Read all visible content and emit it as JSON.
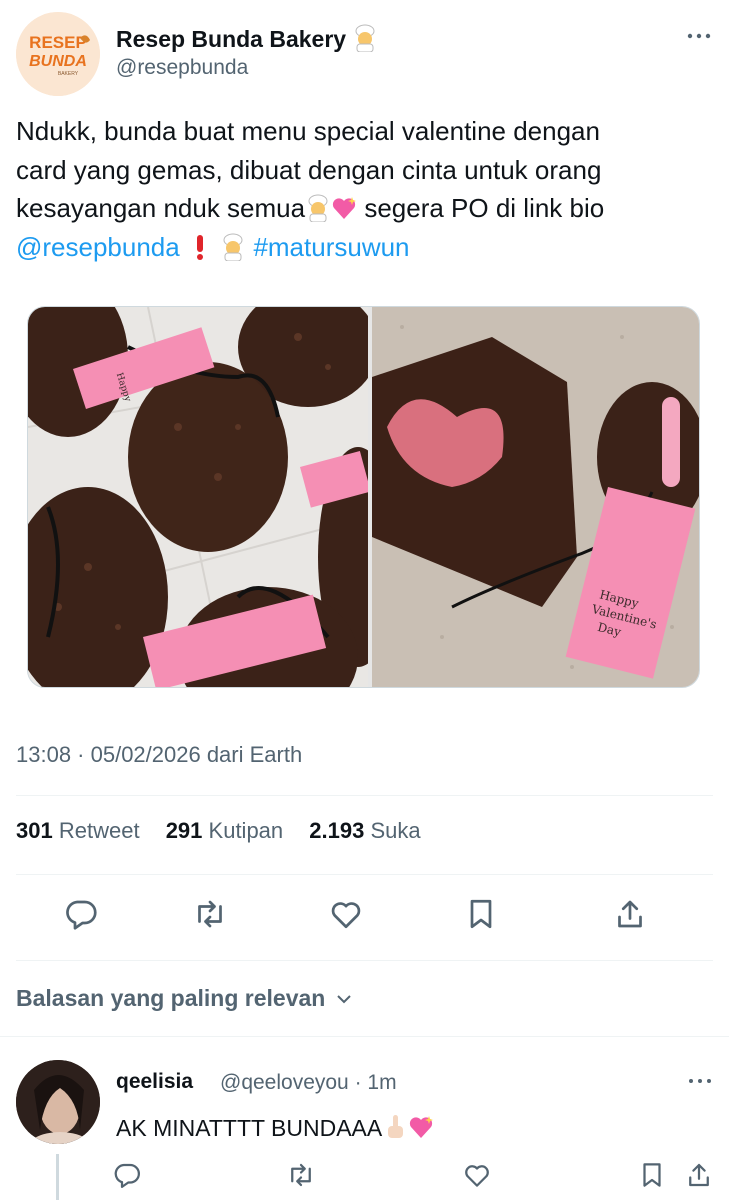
{
  "author": {
    "name": "Resep Bunda Bakery",
    "handle": "@resepbunda",
    "logo_text_top": "RESEP",
    "logo_text_bottom": "BUNDA",
    "logo_text_small": "BAKERY"
  },
  "tweet": {
    "line1": "Ndukk, bunda buat menu special valentine dengan",
    "line2": "card yang gemas, dibuat dengan cinta untuk orang",
    "line3_start": "kesayangan nduk semua",
    "line3_end": " segera PO di link bio",
    "mention": "@resepbunda",
    "hashtag": "#matursuwun"
  },
  "media": {
    "tag_text_1": "Happy",
    "tag_text_2": "Valentine's",
    "tag_text_3": "Day"
  },
  "timestamp": "13:08 · 05/02/2026 dari Earth",
  "stats": {
    "retweets_count": "301",
    "retweets_label": "Retweet",
    "quotes_count": "291",
    "quotes_label": "Kutipan",
    "likes_count": "2.193",
    "likes_label": "Suka"
  },
  "replies_header": "Balasan yang paling relevan",
  "reply": {
    "name": "qeelisia",
    "meta": "@qeeloveyou · 1m",
    "text": "AK MINATTTT BUNDAAA"
  },
  "icons": {
    "reply": "reply-icon",
    "retweet": "retweet-icon",
    "like": "heart-icon",
    "bookmark": "bookmark-icon",
    "share": "share-icon",
    "more": "more-icon",
    "chevron": "chevron-down-icon"
  },
  "colors": {
    "link": "#1d9bf0",
    "muted": "#536471",
    "text": "#0f1419",
    "chocolate": "#3b2218",
    "tag_pink": "#f58fb4"
  }
}
